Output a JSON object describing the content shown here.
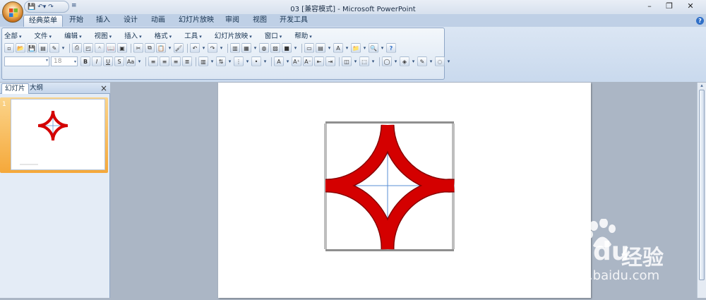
{
  "window": {
    "title": "03 [兼容模式] - Microsoft PowerPoint",
    "minimize_icon": "minimize-icon",
    "restore_icon": "restore-icon",
    "close_icon": "close-icon"
  },
  "ribbon_tabs": [
    {
      "label": "经典菜单"
    },
    {
      "label": "开始"
    },
    {
      "label": "插入"
    },
    {
      "label": "设计"
    },
    {
      "label": "动画"
    },
    {
      "label": "幻灯片放映"
    },
    {
      "label": "审阅"
    },
    {
      "label": "视图"
    },
    {
      "label": "开发工具"
    }
  ],
  "classic_menu": [
    {
      "label": "全部"
    },
    {
      "label": "文件"
    },
    {
      "label": "编辑"
    },
    {
      "label": "视图"
    },
    {
      "label": "插入"
    },
    {
      "label": "格式"
    },
    {
      "label": "工具"
    },
    {
      "label": "幻灯片放映"
    },
    {
      "label": "窗口"
    },
    {
      "label": "帮助"
    }
  ],
  "toolbar": {
    "font_name": "",
    "font_size": "18"
  },
  "slides_pane": {
    "tab_slides": "幻灯片",
    "tab_outline": "大纲",
    "close": "×",
    "thumbnail_number": "1"
  },
  "watermark": {
    "brand": "Bai",
    "brand2": "du",
    "cn": "经验",
    "url": "jingyan.baidu.com"
  },
  "colors": {
    "shape_red": "#d40000",
    "shape_outline": "#8a0000",
    "guide_blue": "#5a8fd6",
    "selected_thumb": "#f5a83a"
  }
}
